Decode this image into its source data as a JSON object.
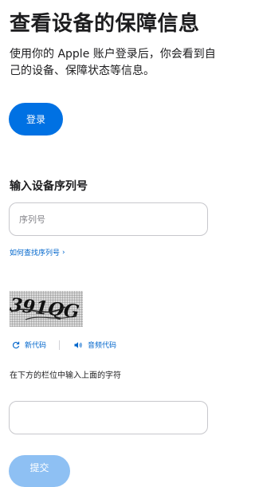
{
  "header": {
    "title": "查看设备的保障信息",
    "intro": "使用你的 Apple 账户登录后，你会看到自己的设备、保障状态等信息。"
  },
  "signin": {
    "label": "登录"
  },
  "serial": {
    "heading": "输入设备序列号",
    "placeholder": "序列号",
    "value": "",
    "help_link": "如何查找序列号"
  },
  "captcha": {
    "image_text": "391QG",
    "new_code_label": "新代码",
    "audio_code_label": "音频代码",
    "instruction": "在下方的栏位中输入上面的字符",
    "value": ""
  },
  "submit": {
    "label": "提交"
  },
  "colors": {
    "accent": "#0071e3",
    "link": "#0066cc",
    "disabled_button": "#8ec0f3"
  }
}
